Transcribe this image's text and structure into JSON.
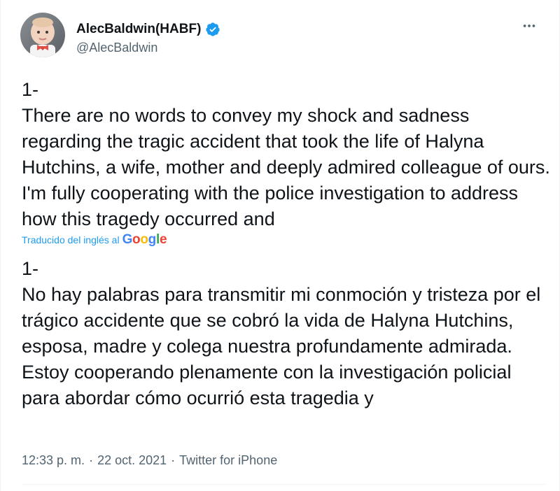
{
  "author": {
    "display_name": "AlecBaldwin(HABF)",
    "handle": "@AlecBaldwin",
    "verified_icon": "verified-badge-icon",
    "avatar": "avatar-photo"
  },
  "menu": {
    "more_icon": "more-horizontal-icon"
  },
  "tweet": {
    "original_text": "1-\nThere are no words to convey my shock and sadness regarding the tragic accident that took the life of Halyna Hutchins, a wife, mother and deeply admired colleague of ours. I'm fully cooperating with the police investigation to address how this tragedy occurred and",
    "translated_by_label": "Traducido del inglés al",
    "translated_by_brand": "Google",
    "translated_text": "1-\n No hay palabras para transmitir mi conmoción y tristeza por el trágico accidente que se cobró la vida de Halyna Hutchins, esposa, madre y colega nuestra profundamente admirada. Estoy cooperando plenamente con la investigación policial para abordar cómo ocurrió esta tragedia y"
  },
  "meta": {
    "time": "12:33 p. m.",
    "separator1": "·",
    "date": "22 oct. 2021",
    "separator2": "·",
    "source": "Twitter for iPhone"
  },
  "colors": {
    "text": "#0f1419",
    "secondary": "#536471",
    "link": "#1d9bf0",
    "verified": "#1d9bf0"
  }
}
